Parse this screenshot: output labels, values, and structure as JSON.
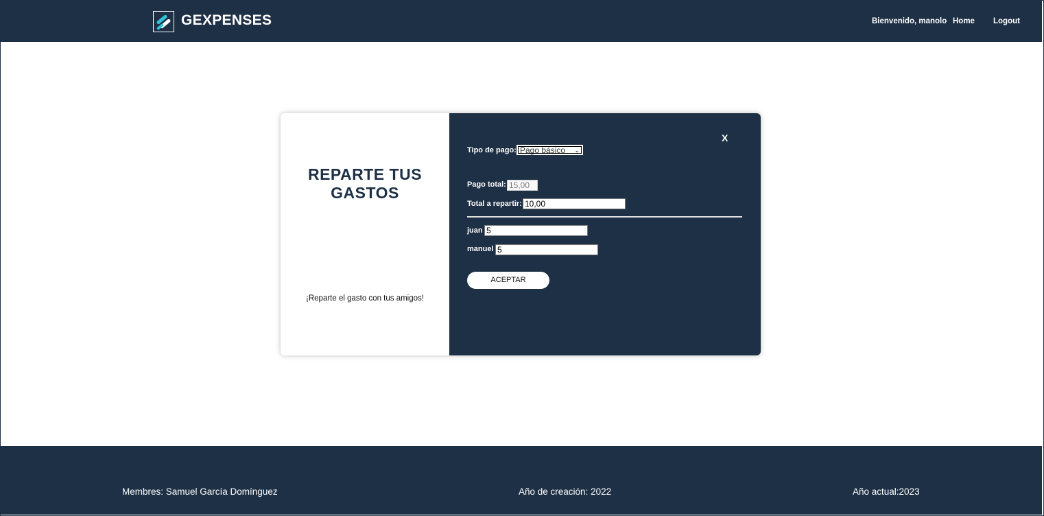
{
  "header": {
    "brand": "GEXPENSES",
    "welcome": "Bienvenido, manolo",
    "home": "Home",
    "logout": "Logout"
  },
  "modal": {
    "title_line1": "REPARTE TUS",
    "title_line2": "GASTOS",
    "subtitle": "¡Reparte el gasto con tus amigos!",
    "close": "X",
    "payment_type_label": "Tipo de pago:",
    "payment_type_selected": "Pago básico",
    "total_label": "Pago total:",
    "total_value": "15,00",
    "to_split_label": "Total a repartir:",
    "to_split_value": "10,00",
    "members": [
      {
        "name": "juan",
        "amount": "5"
      },
      {
        "name": "manuel",
        "amount": "5"
      }
    ],
    "accept": "ACEPTAR"
  },
  "footer": {
    "members": "Membres: Samuel García Domínguez",
    "created": "Año de creación: 2022",
    "current": "Año actual:2023"
  },
  "colors": {
    "navy": "#1e3045",
    "white": "#ffffff"
  }
}
